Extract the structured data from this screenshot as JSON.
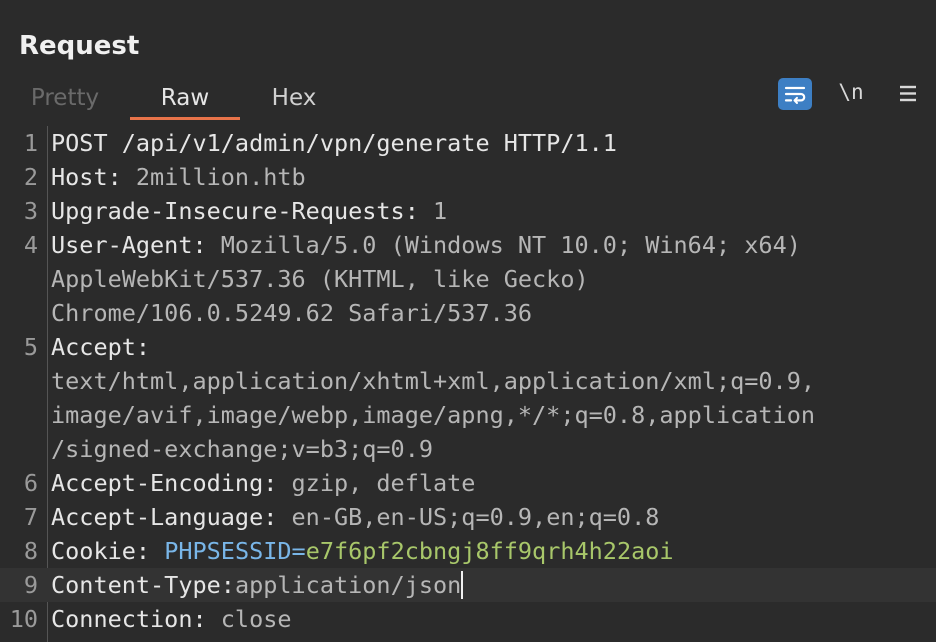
{
  "panel": {
    "title": "Request"
  },
  "tabs": [
    {
      "label": "Pretty",
      "state": "disabled"
    },
    {
      "label": "Raw",
      "state": "active"
    },
    {
      "label": "Hex",
      "state": "normal"
    }
  ],
  "toolbar": {
    "wrap_icon": "word-wrap-icon",
    "newline_label": "\\n",
    "menu_icon": "hamburger-menu-icon"
  },
  "colors": {
    "accent_tab": "#e8744a",
    "wrap_button": "#3d7fc4",
    "cookie_name": "#79b6e8",
    "cookie_value": "#a8c76a"
  },
  "lines": [
    {
      "num": "1",
      "rows": [
        [
          "POST /api/v1/admin/vpn/generate HTTP/1.1"
        ]
      ]
    },
    {
      "num": "2",
      "key": "Host:",
      "val": " 2million.htb"
    },
    {
      "num": "3",
      "key": "Upgrade-Insecure-Requests:",
      "val": " 1"
    },
    {
      "num": "4",
      "key": "User-Agent:",
      "val": " Mozilla/5.0 (Windows NT 10.0; Win64; x64)",
      "cont": [
        "AppleWebKit/537.36 (KHTML, like Gecko)",
        "Chrome/106.0.5249.62 Safari/537.36"
      ]
    },
    {
      "num": "5",
      "key": "Accept:",
      "val": "",
      "cont": [
        "text/html,application/xhtml+xml,application/xml;q=0.9,",
        "image/avif,image/webp,image/apng,*/*;q=0.8,application",
        "/signed-exchange;v=b3;q=0.9"
      ]
    },
    {
      "num": "6",
      "key": "Accept-Encoding:",
      "val": " gzip, deflate"
    },
    {
      "num": "7",
      "key": "Accept-Language:",
      "val": " en-GB,en-US;q=0.9,en;q=0.8"
    },
    {
      "num": "8",
      "key": "Cookie:",
      "val": " ",
      "cookie_name": "PHPSESSID=",
      "cookie_value": "e7f6pf2cbngj8ff9qrh4h22aoi"
    },
    {
      "num": "9",
      "key": "Content-Type:",
      "val": "application/json"
    },
    {
      "num": "10",
      "key": "Connection:",
      "val": " close"
    }
  ]
}
